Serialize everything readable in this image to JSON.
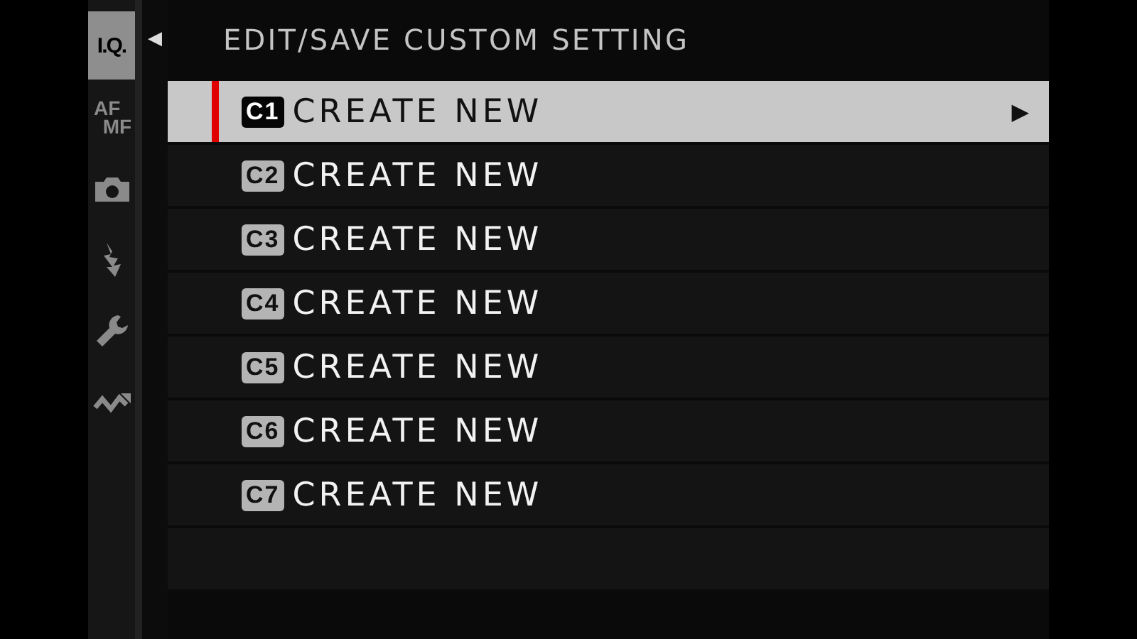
{
  "sidebar": {
    "tabs": [
      {
        "kind": "text",
        "label": "I.Q.",
        "selected": true
      },
      {
        "kind": "stacked",
        "label": "AF",
        "label_2": "MF",
        "selected": false
      },
      {
        "kind": "camera",
        "selected": false
      },
      {
        "kind": "flash",
        "selected": false
      },
      {
        "kind": "wrench",
        "selected": false
      },
      {
        "kind": "wave",
        "selected": false
      }
    ]
  },
  "back_arrow": "◀",
  "menu": {
    "title": "EDIT/SAVE CUSTOM SETTING",
    "items": [
      {
        "badge": "C1",
        "label": "CREATE NEW",
        "selected": true,
        "submenu_arrow": "▶"
      },
      {
        "badge": "C2",
        "label": "CREATE NEW",
        "selected": false
      },
      {
        "badge": "C3",
        "label": "CREATE NEW",
        "selected": false
      },
      {
        "badge": "C4",
        "label": "CREATE NEW",
        "selected": false
      },
      {
        "badge": "C5",
        "label": "CREATE NEW",
        "selected": false
      },
      {
        "badge": "C6",
        "label": "CREATE NEW",
        "selected": false
      },
      {
        "badge": "C7",
        "label": "CREATE NEW",
        "selected": false
      }
    ]
  }
}
